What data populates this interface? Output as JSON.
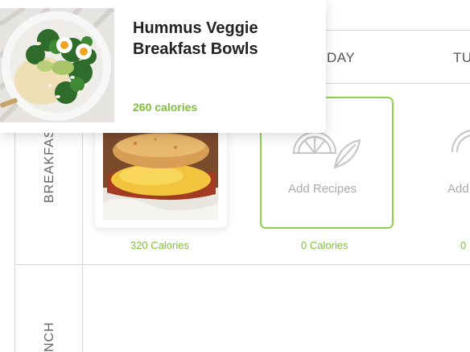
{
  "popup": {
    "title_line1": "Hummus Veggie",
    "title_line2": "Breakfast Bowls",
    "calories": "260 calories"
  },
  "days": {
    "col1": "DAY",
    "col2": "TU"
  },
  "meals": {
    "breakfast": "BREAKFAST",
    "lunch": "NCH"
  },
  "recipe": {
    "calories": "320 Calories"
  },
  "slot": {
    "add_label_1": "Add Recipes",
    "add_label_2": "Add",
    "calories_1": "0 Calories",
    "calories_2": "0"
  },
  "colors": {
    "accent_green": "#7fbf3a",
    "border_green": "#8fd14f",
    "grid_line": "#d6d6d6"
  }
}
